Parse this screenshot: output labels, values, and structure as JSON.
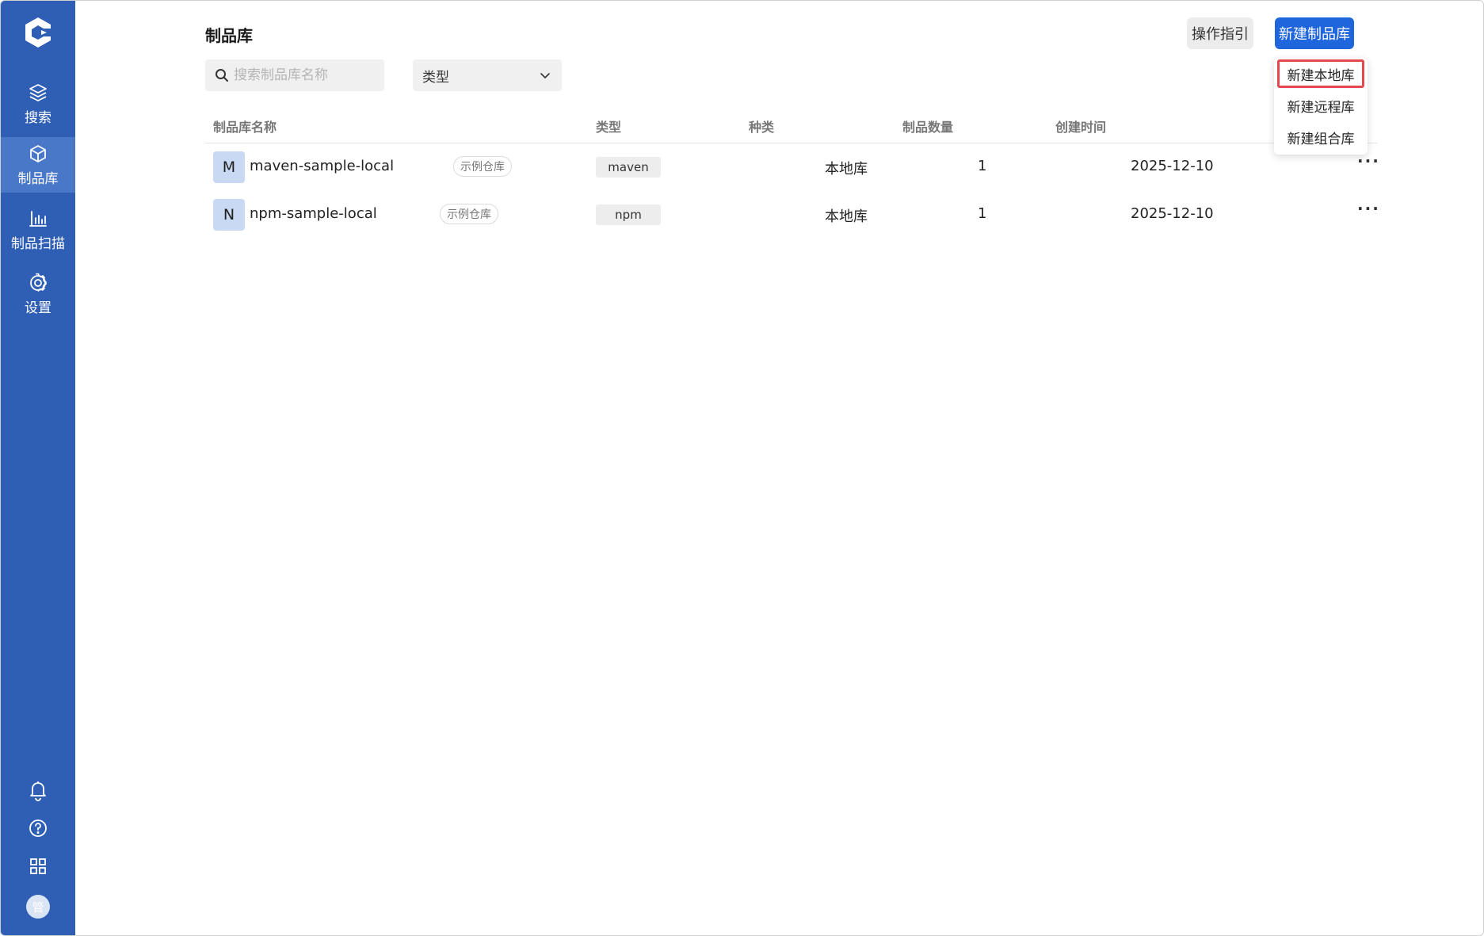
{
  "sidebar": {
    "items": [
      {
        "label": "搜索",
        "icon": "layers-icon"
      },
      {
        "label": "制品库",
        "icon": "cube-icon"
      },
      {
        "label": "制品扫描",
        "icon": "bar-chart-icon"
      },
      {
        "label": "设置",
        "icon": "gear-icon"
      }
    ],
    "avatar_text": "管"
  },
  "page": {
    "title": "制品库",
    "guide_button": "操作指引",
    "new_button": "新建制品库"
  },
  "filters": {
    "search_placeholder": "搜索制品库名称",
    "type_select": "类型"
  },
  "table": {
    "columns": [
      "制品库名称",
      "类型",
      "种类",
      "制品数量",
      "创建时间"
    ],
    "rows": [
      {
        "avatar": "M",
        "name": "maven-sample-local",
        "badge": "示例仓库",
        "type": "maven",
        "kind": "本地库",
        "count": "1",
        "created": "2025-12-10"
      },
      {
        "avatar": "N",
        "name": "npm-sample-local",
        "badge": "示例仓库",
        "type": "npm",
        "kind": "本地库",
        "count": "1",
        "created": "2025-12-10"
      }
    ]
  },
  "dropdown": {
    "items": [
      "新建本地库",
      "新建远程库",
      "新建组合库"
    ]
  },
  "colors": {
    "sidebar": "#2f5fb5",
    "sidebar_active": "#4a78c9",
    "primary": "#1f66dd",
    "highlight": "#e5484d"
  }
}
